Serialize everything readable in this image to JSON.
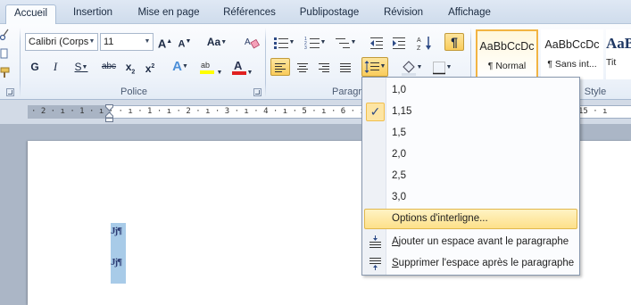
{
  "tabs": [
    "Accueil",
    "Insertion",
    "Mise en page",
    "Références",
    "Publipostage",
    "Révision",
    "Affichage"
  ],
  "font_group": {
    "font_name": "Calibri (Corps",
    "font_size": "11",
    "label": "Police"
  },
  "paragraph_group": {
    "label": "Paragr"
  },
  "styles_group": {
    "label": "Style",
    "tiles": [
      {
        "sample": "AaBbCcDc",
        "name": "¶ Normal"
      },
      {
        "sample": "AaBbCcDc",
        "name": "¶ Sans int..."
      },
      {
        "sample": "AaB",
        "name": "Tit"
      }
    ]
  },
  "ruler": {
    "marks": "· 2 · ı · 1 · ı ·        · ı · 1 · ı · 2 · ı · 3 · ı · 4 · ı · 5 · ı · 6 · ı · 7 · ı ·",
    "right_marks": "15 · ı"
  },
  "document": {
    "lines": [
      "Jj¶",
      "Jj¶"
    ]
  },
  "line_spacing_menu": {
    "options": [
      "1,0",
      "1,15",
      "1,5",
      "2,0",
      "2,5",
      "3,0"
    ],
    "checked_option": "1,15",
    "options_item": "Options d'interligne...",
    "add_space_before_prefix": "A",
    "add_space_before_rest": "jouter un espace avant le paragraphe",
    "remove_space_after_prefix": "S",
    "remove_space_after_rest": "upprimer l'espace après le paragraphe"
  },
  "colors": {
    "accent_highlight": "#fde089",
    "selection": "#a8cbe8",
    "font_color_red": "#e02020",
    "highlight_yellow": "#ffff00"
  }
}
